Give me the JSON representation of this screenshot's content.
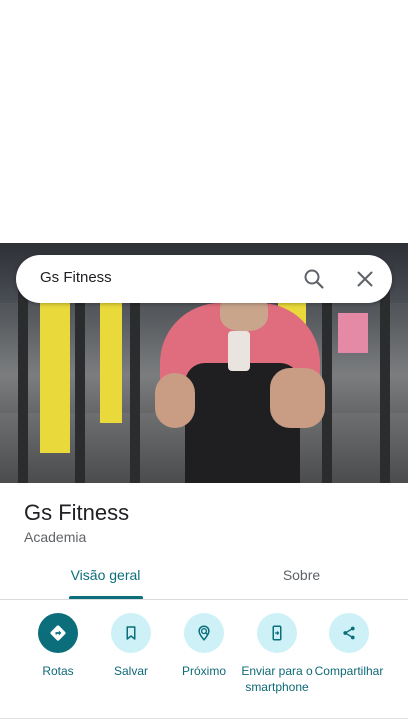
{
  "search": {
    "query": "Gs Fitness"
  },
  "place": {
    "title": "Gs Fitness",
    "category": "Academia"
  },
  "tabs": [
    {
      "label": "Visão geral",
      "active": true
    },
    {
      "label": "Sobre",
      "active": false
    }
  ],
  "actions": [
    {
      "label": "Rotas",
      "icon": "directions-icon"
    },
    {
      "label": "Salvar",
      "icon": "bookmark-icon"
    },
    {
      "label": "Próximo",
      "icon": "nearby-icon"
    },
    {
      "label": "Enviar para o smartphone",
      "icon": "send-to-phone-icon"
    },
    {
      "label": "Compartilhar",
      "icon": "share-icon"
    }
  ],
  "colors": {
    "accent": "#0b6e7a",
    "action_bg": "#cdf1f6",
    "label": "#0e6977"
  }
}
